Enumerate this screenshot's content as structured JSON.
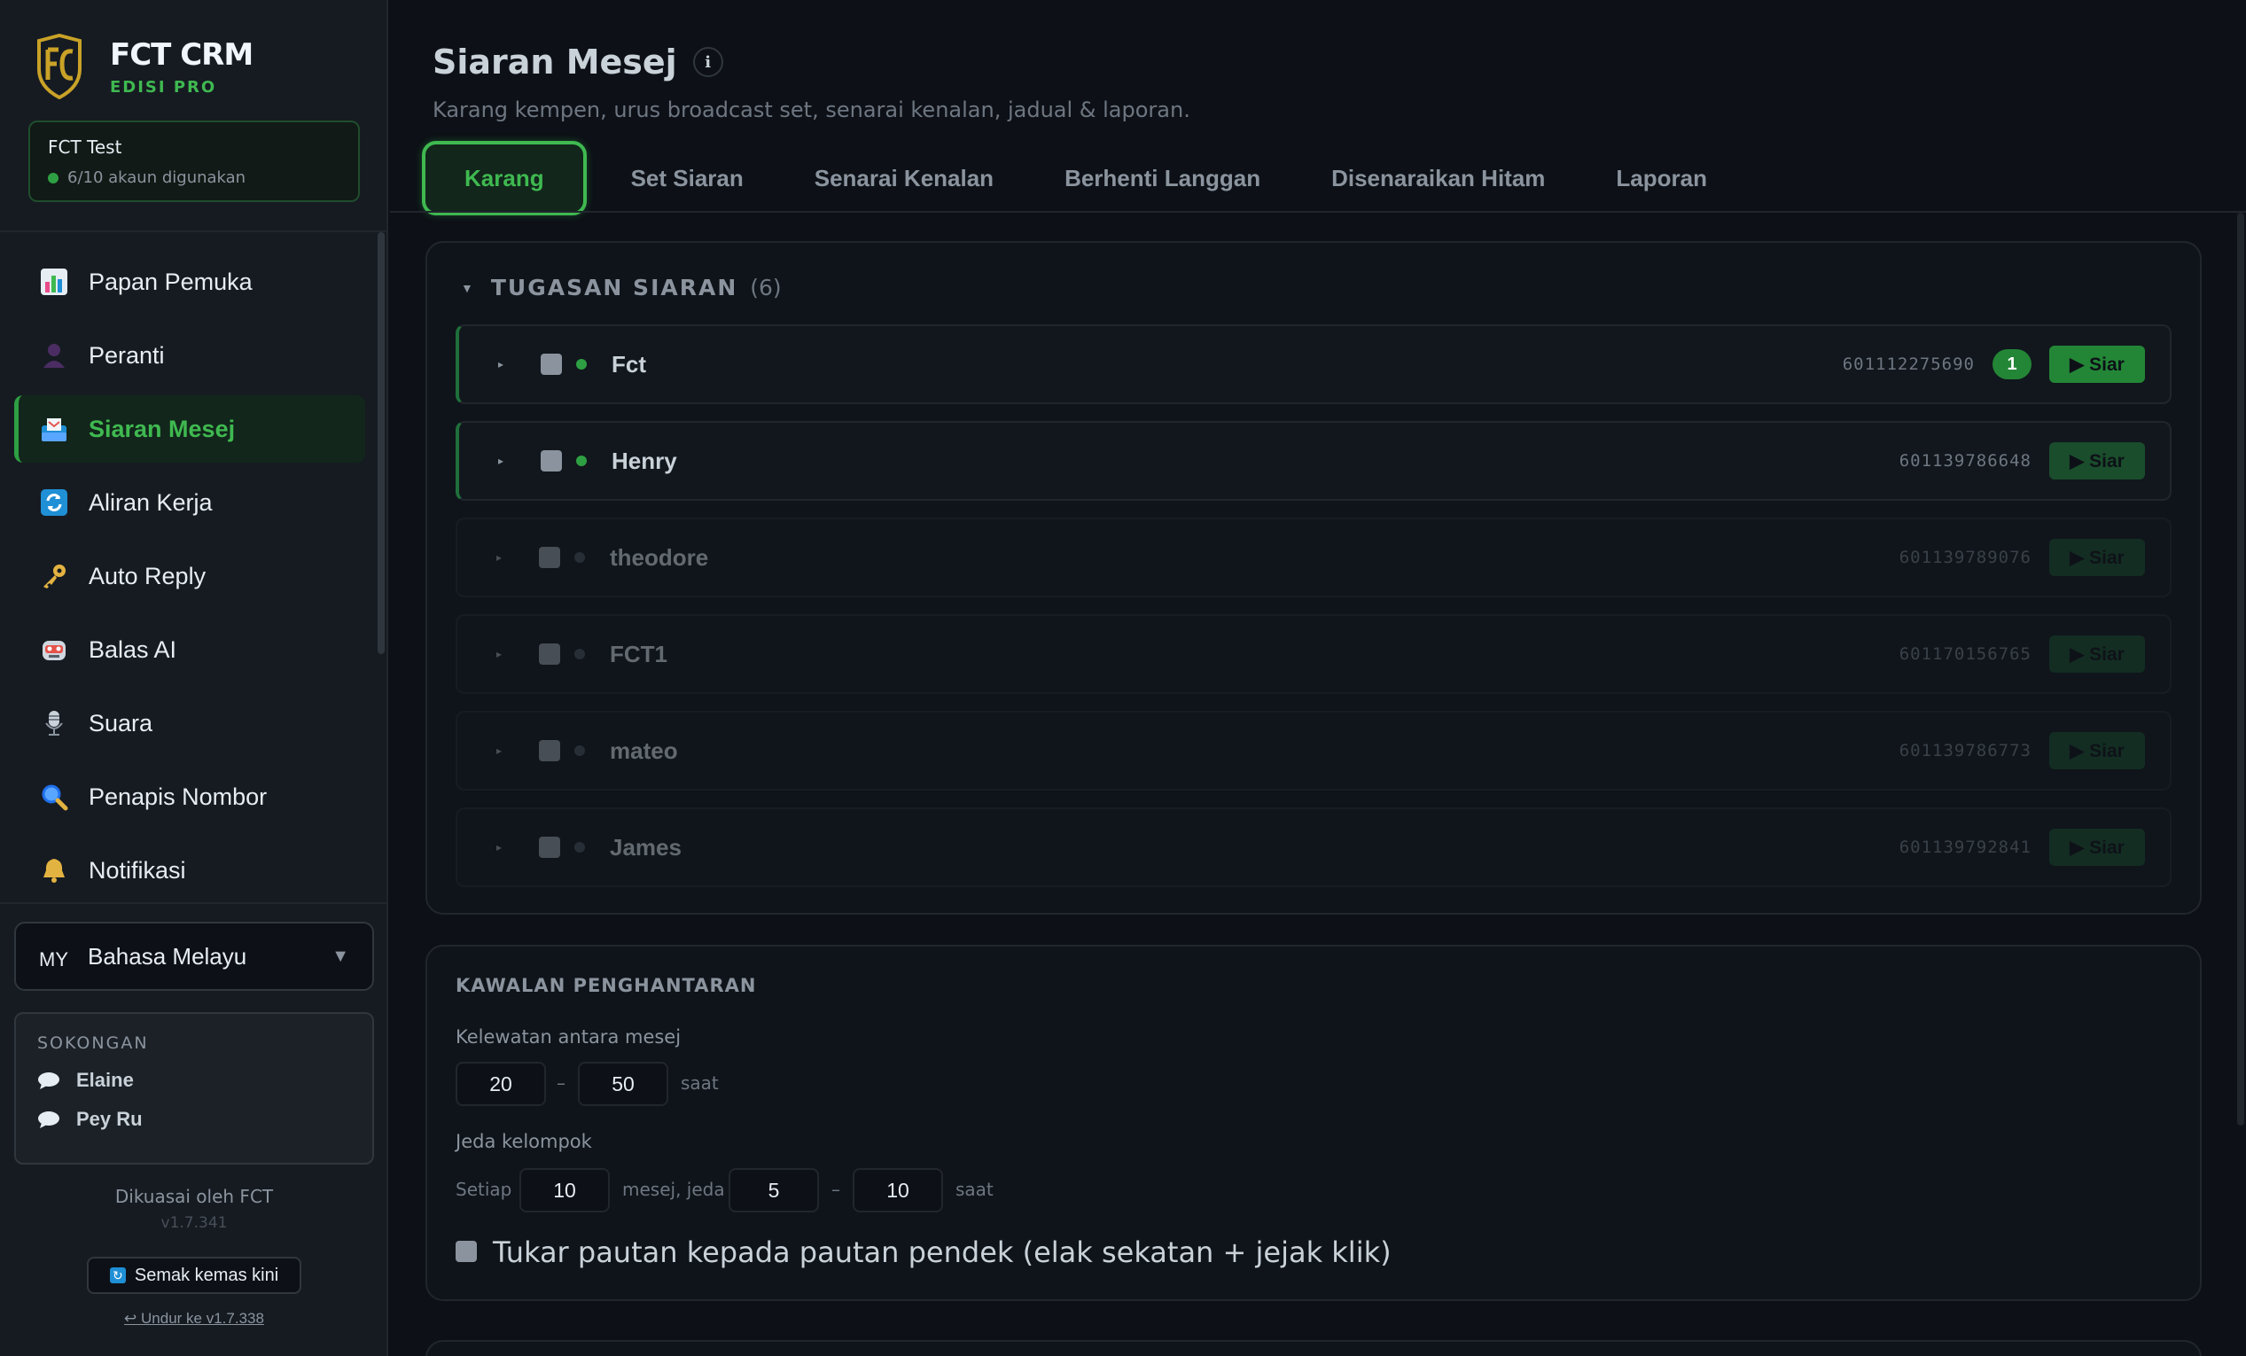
{
  "sidebar": {
    "brand_title": "FCT CRM",
    "brand_sub": "EDISI PRO",
    "account_name": "FCT Test",
    "account_usage": "6/10 akaun digunakan",
    "nav": [
      {
        "label": "Papan Pemuka",
        "icon": "chart-icon",
        "active": false
      },
      {
        "label": "Peranti",
        "icon": "user-icon",
        "active": false
      },
      {
        "label": "Siaran Mesej",
        "icon": "inbox-icon",
        "active": true
      },
      {
        "label": "Aliran Kerja",
        "icon": "refresh-icon",
        "active": false
      },
      {
        "label": "Auto Reply",
        "icon": "key-icon",
        "active": false
      },
      {
        "label": "Balas AI",
        "icon": "robot-icon",
        "active": false
      },
      {
        "label": "Suara",
        "icon": "microphone-icon",
        "active": false
      },
      {
        "label": "Penapis Nombor",
        "icon": "magnifier-icon",
        "active": false
      },
      {
        "label": "Notifikasi",
        "icon": "bell-icon",
        "active": false
      }
    ],
    "language_code": "MY",
    "language_label": "Bahasa Melayu",
    "support_title": "SOKONGAN",
    "support_contacts": [
      "Elaine",
      "Pey Ru"
    ],
    "powered_by": "Dikuasai oleh FCT",
    "version": "v1.7.341",
    "update_label": "Semak kemas kini",
    "rollback_label": "↩ Undur ke v1.7.338"
  },
  "main": {
    "title": "Siaran Mesej",
    "info_icon": "i",
    "subtitle": "Karang kempen, urus broadcast set, senarai kenalan, jadual & laporan.",
    "tabs": [
      "Karang",
      "Set Siaran",
      "Senarai Kenalan",
      "Berhenti Langgan",
      "Disenaraikan Hitam",
      "Laporan"
    ],
    "active_tab": "Karang"
  },
  "tasks_panel": {
    "title": "TUGASAN SIARAN",
    "count": "(6)",
    "button_label": "▶ Siar",
    "tasks": [
      {
        "name": "Fct",
        "phone": "601112275690",
        "badge": "1",
        "status": "online"
      },
      {
        "name": "Henry",
        "phone": "601139786648",
        "badge": "",
        "status": "online"
      },
      {
        "name": "theodore",
        "phone": "601139789076",
        "badge": "",
        "status": "offline"
      },
      {
        "name": "FCT1",
        "phone": "601170156765",
        "badge": "",
        "status": "offline"
      },
      {
        "name": "mateo",
        "phone": "601139786773",
        "badge": "",
        "status": "offline"
      },
      {
        "name": "James",
        "phone": "601139792841",
        "badge": "",
        "status": "offline"
      }
    ]
  },
  "delivery_panel": {
    "title": "KAWALAN PENGHANTARAN",
    "delay_label": "Kelewatan antara mesej",
    "delay_min": "20",
    "delay_sep": "–",
    "delay_max": "50",
    "delay_unit": "saat",
    "batch_label": "Jeda kelompok",
    "batch_prefix": "Setiap",
    "batch_every": "10",
    "batch_mid": "mesej, jeda",
    "batch_pause_min": "5",
    "batch_sep": "–",
    "batch_pause_max": "10",
    "batch_unit": "saat",
    "shortlink_label": "Tukar pautan kepada pautan pendek (elak sekatan + jejak klik)"
  },
  "colors": {
    "accent": "#3fb950",
    "bg": "#0d1117",
    "sidebar_bg": "#161b22"
  }
}
